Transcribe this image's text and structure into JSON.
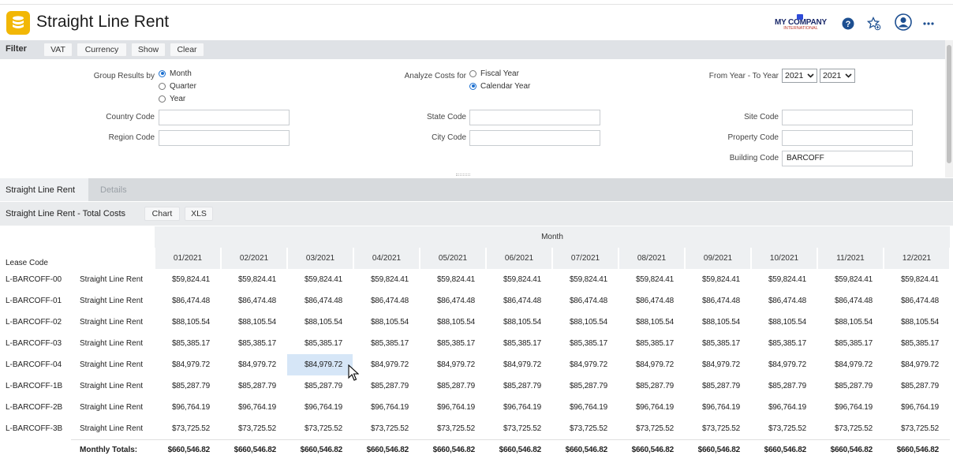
{
  "header": {
    "title": "Straight Line Rent",
    "logo_main": "MY COMPANY",
    "logo_sub": "INTERNATIONAL"
  },
  "filter_bar": {
    "label": "Filter",
    "buttons": [
      "VAT",
      "Currency",
      "Show",
      "Clear"
    ]
  },
  "filters": {
    "group_results_label": "Group Results by",
    "group_options": [
      "Month",
      "Quarter",
      "Year"
    ],
    "group_selected": "Month",
    "analyze_label": "Analyze Costs for",
    "analyze_options": [
      "Fiscal Year",
      "Calendar Year"
    ],
    "analyze_selected": "Calendar Year",
    "year_label": "From Year - To Year",
    "from_year": "2021",
    "to_year": "2021",
    "country_label": "Country Code",
    "country_value": "",
    "region_label": "Region Code",
    "region_value": "",
    "state_label": "State Code",
    "state_value": "",
    "city_label": "City Code",
    "city_value": "",
    "site_label": "Site Code",
    "site_value": "",
    "property_label": "Property Code",
    "property_value": "",
    "building_label": "Building Code",
    "building_value": "BARCOFF"
  },
  "tabs": [
    {
      "label": "Straight Line Rent",
      "active": true
    },
    {
      "label": "Details",
      "active": false
    }
  ],
  "subpanel": {
    "title": "Straight Line Rent - Total Costs",
    "buttons": [
      "Chart",
      "XLS"
    ]
  },
  "table": {
    "group_header": "Month",
    "lease_header": "Lease Code",
    "months": [
      "01/2021",
      "02/2021",
      "03/2021",
      "04/2021",
      "05/2021",
      "06/2021",
      "07/2021",
      "08/2021",
      "09/2021",
      "10/2021",
      "11/2021",
      "12/2021"
    ],
    "rows": [
      {
        "code": "L-BARCOFF-00",
        "type": "Straight Line Rent",
        "value": "$59,824.41"
      },
      {
        "code": "L-BARCOFF-01",
        "type": "Straight Line Rent",
        "value": "$86,474.48"
      },
      {
        "code": "L-BARCOFF-02",
        "type": "Straight Line Rent",
        "value": "$88,105.54"
      },
      {
        "code": "L-BARCOFF-03",
        "type": "Straight Line Rent",
        "value": "$85,385.17"
      },
      {
        "code": "L-BARCOFF-04",
        "type": "Straight Line Rent",
        "value": "$84,979.72"
      },
      {
        "code": "L-BARCOFF-1B",
        "type": "Straight Line Rent",
        "value": "$85,287.79"
      },
      {
        "code": "L-BARCOFF-2B",
        "type": "Straight Line Rent",
        "value": "$96,764.19"
      },
      {
        "code": "L-BARCOFF-3B",
        "type": "Straight Line Rent",
        "value": "$73,725.52"
      }
    ],
    "highlighted_row": 4,
    "highlighted_col": 2,
    "totals_label": "Monthly Totals:",
    "totals_value": "$660,546.82"
  },
  "colors": {
    "accent": "#1b6fd0",
    "app_icon": "#f2b705",
    "filter_bar": "#dfe2e6",
    "tabs_bar": "#d7dadd",
    "highlight": "#d6e6f7"
  },
  "icons": [
    "database-icon",
    "help-icon",
    "favorite-add-icon",
    "user-icon",
    "more-icon"
  ]
}
